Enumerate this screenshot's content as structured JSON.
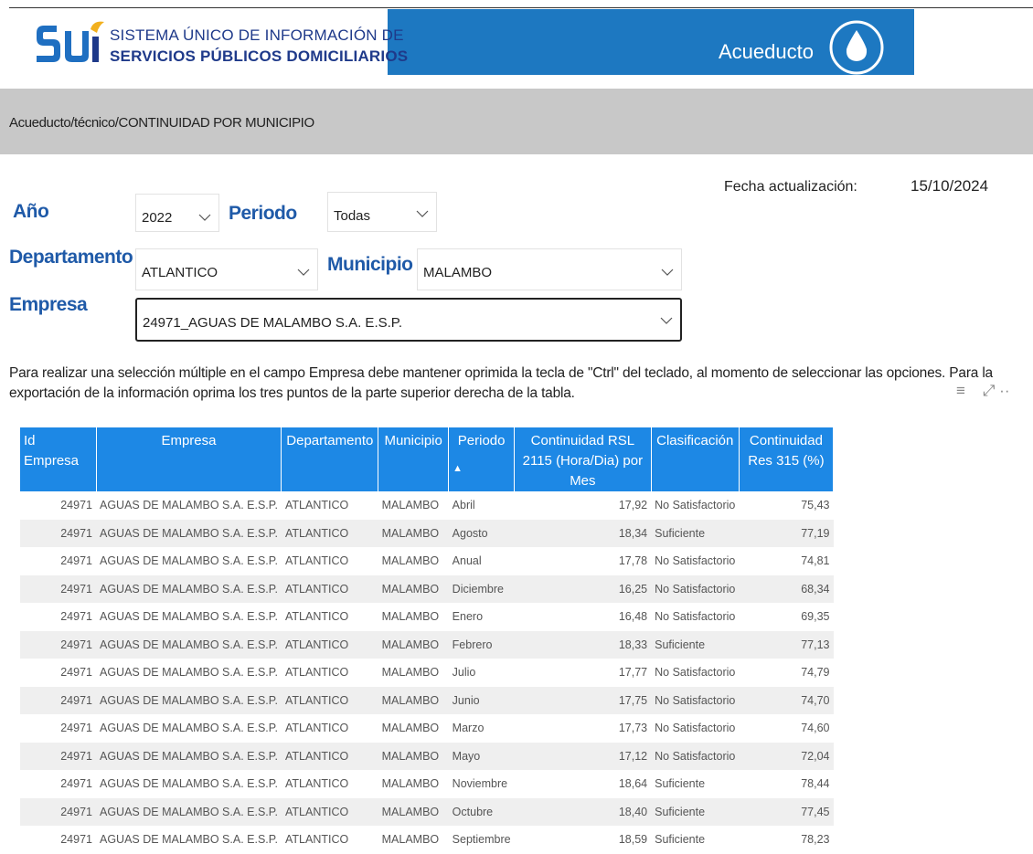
{
  "header": {
    "logo_line1": "SISTEMA ÚNICO DE INFORMACIÓN DE",
    "logo_line2": "SERVICIOS PÚBLICOS DOMICILIARIOS",
    "logo_mark": "SUI",
    "service_title": "Acueducto",
    "service_icon": "water-drop-icon",
    "brand_color": "#1d78c1"
  },
  "breadcrumb": "Acueducto/técnico/CONTINUIDAD POR MUNICIPIO",
  "update": {
    "label": "Fecha actualización:",
    "value": "15/10/2024"
  },
  "filters": {
    "year": {
      "label": "Año",
      "value": "2022"
    },
    "period": {
      "label": "Periodo",
      "value": "Todas"
    },
    "department": {
      "label": "Departamento",
      "value": "ATLANTICO"
    },
    "municipality": {
      "label": "Municipio",
      "value": "MALAMBO"
    },
    "company": {
      "label": "Empresa",
      "value": "24971_AGUAS DE MALAMBO S.A. E.S.P."
    }
  },
  "note": "Para realizar una selección múltiple en el campo Empresa debe mantener oprimida la tecla de \"Ctrl\" del teclado, al momento de seleccionar las opciones. Para la exportación de la información oprima los tres puntos de la parte superior derecha de la tabla.",
  "table": {
    "header_color": "#1d88e5",
    "columns": [
      "Id Empresa",
      "Empresa",
      "Departamento",
      "Municipio",
      "Periodo",
      "Continuidad RSL 2115 (Hora/Dia) por Mes",
      "Clasificación",
      "Continuidad Res 315 (%)"
    ],
    "rows": [
      [
        "24971",
        "AGUAS DE MALAMBO S.A. E.S.P.",
        "ATLANTICO",
        "MALAMBO",
        "Abril",
        "17,92",
        "No Satisfactorio",
        "75,43"
      ],
      [
        "24971",
        "AGUAS DE MALAMBO S.A. E.S.P.",
        "ATLANTICO",
        "MALAMBO",
        "Agosto",
        "18,34",
        "Suficiente",
        "77,19"
      ],
      [
        "24971",
        "AGUAS DE MALAMBO S.A. E.S.P.",
        "ATLANTICO",
        "MALAMBO",
        "Anual",
        "17,78",
        "No Satisfactorio",
        "74,81"
      ],
      [
        "24971",
        "AGUAS DE MALAMBO S.A. E.S.P.",
        "ATLANTICO",
        "MALAMBO",
        "Diciembre",
        "16,25",
        "No Satisfactorio",
        "68,34"
      ],
      [
        "24971",
        "AGUAS DE MALAMBO S.A. E.S.P.",
        "ATLANTICO",
        "MALAMBO",
        "Enero",
        "16,48",
        "No Satisfactorio",
        "69,35"
      ],
      [
        "24971",
        "AGUAS DE MALAMBO S.A. E.S.P.",
        "ATLANTICO",
        "MALAMBO",
        "Febrero",
        "18,33",
        "Suficiente",
        "77,13"
      ],
      [
        "24971",
        "AGUAS DE MALAMBO S.A. E.S.P.",
        "ATLANTICO",
        "MALAMBO",
        "Julio",
        "17,77",
        "No Satisfactorio",
        "74,79"
      ],
      [
        "24971",
        "AGUAS DE MALAMBO S.A. E.S.P.",
        "ATLANTICO",
        "MALAMBO",
        "Junio",
        "17,75",
        "No Satisfactorio",
        "74,70"
      ],
      [
        "24971",
        "AGUAS DE MALAMBO S.A. E.S.P.",
        "ATLANTICO",
        "MALAMBO",
        "Marzo",
        "17,73",
        "No Satisfactorio",
        "74,60"
      ],
      [
        "24971",
        "AGUAS DE MALAMBO S.A. E.S.P.",
        "ATLANTICO",
        "MALAMBO",
        "Mayo",
        "17,12",
        "No Satisfactorio",
        "72,04"
      ],
      [
        "24971",
        "AGUAS DE MALAMBO S.A. E.S.P.",
        "ATLANTICO",
        "MALAMBO",
        "Noviembre",
        "18,64",
        "Suficiente",
        "78,44"
      ],
      [
        "24971",
        "AGUAS DE MALAMBO S.A. E.S.P.",
        "ATLANTICO",
        "MALAMBO",
        "Octubre",
        "18,40",
        "Suficiente",
        "77,45"
      ],
      [
        "24971",
        "AGUAS DE MALAMBO S.A. E.S.P.",
        "ATLANTICO",
        "MALAMBO",
        "Septiembre",
        "18,59",
        "Suficiente",
        "78,23"
      ]
    ]
  }
}
